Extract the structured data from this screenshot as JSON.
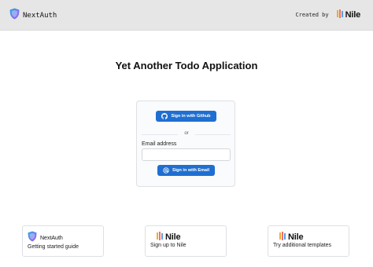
{
  "header": {
    "brand_name": "NextAuth",
    "created_by": "Created by",
    "nile_logo_text": "Nile"
  },
  "main": {
    "title": "Yet Another Todo Application"
  },
  "signin": {
    "github_label": "Sign in with Github",
    "divider_text": "or",
    "email_label": "Email address",
    "email_value": "",
    "email_placeholder": "",
    "email_button_label": "Sign in with Email"
  },
  "tiles": [
    {
      "logo_text": "NextAuth",
      "description": "Getting started guide"
    },
    {
      "logo_text": "Nile",
      "description": "Sign up to Nile"
    },
    {
      "logo_text": "Nile",
      "description": "Try additional templates"
    }
  ],
  "colors": {
    "header_bg": "#e6e6e6",
    "primary_button": "#1f6fd1",
    "shield_top": "#2ea8e0",
    "shield_bottom": "#a855f7"
  },
  "icons": {
    "brand": "nextauth-shield-icon",
    "nile": "nile-bars-icon",
    "github": "github-icon",
    "email": "at-sign-icon"
  }
}
